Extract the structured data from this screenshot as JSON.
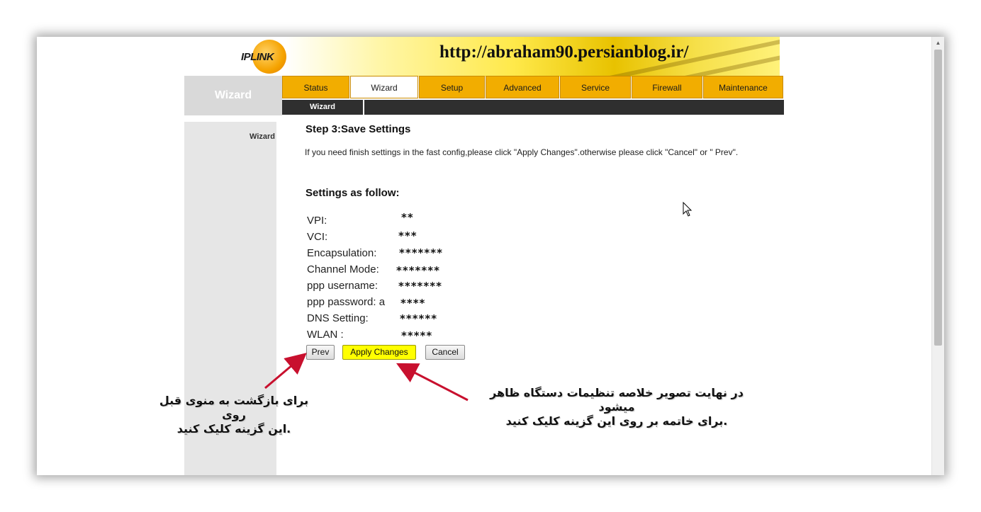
{
  "banner": {
    "logo_text": "IPLINK",
    "url": "http://abraham90.persianblog.ir/"
  },
  "sidebar": {
    "title": "Wizard",
    "items": [
      {
        "label": "Wizard"
      }
    ]
  },
  "nav": {
    "tabs": [
      {
        "label": "Status"
      },
      {
        "label": "Wizard"
      },
      {
        "label": "Setup"
      },
      {
        "label": "Advanced"
      },
      {
        "label": "Service"
      },
      {
        "label": "Firewall"
      },
      {
        "label": "Maintenance"
      }
    ],
    "active_tab": "Wizard",
    "sub_items": [
      {
        "label": "Wizard"
      }
    ]
  },
  "main": {
    "step_title": "Step 3:Save Settings",
    "instruction": "If you need finish settings in the fast config,please click \"Apply Changes\".otherwise please click \"Cancel\" or \" Prev\".",
    "settings_title": "Settings as follow:",
    "settings": [
      {
        "label": "VPI:",
        "masked": "**"
      },
      {
        "label": "VCI:",
        "masked": "***"
      },
      {
        "label": "Encapsulation:",
        "masked": "*******"
      },
      {
        "label": "Channel Mode:",
        "masked": "*******"
      },
      {
        "label": "ppp username:",
        "masked": "*******"
      },
      {
        "label": "ppp password: a",
        "masked": "****"
      },
      {
        "label": "DNS Setting:",
        "masked": "******"
      },
      {
        "label": "WLAN :",
        "masked": "*****"
      }
    ]
  },
  "buttons": {
    "prev": "Prev",
    "apply": "Apply Changes",
    "cancel": "Cancel"
  },
  "annotations": {
    "left_line1": "برای بازگشت به منوی قبل روی",
    "left_line2": ".این گزینه کلیک کنید",
    "right_line1": "در نهایت تصویر خلاصه تنظیمات دستگاه ظاهر میشود",
    "right_line2": ".برای خاتمه بر روی این گزینه کلیک کنید"
  },
  "colors": {
    "nav_tab": "#f2ad00",
    "subnav": "#2f2f2f",
    "apply_button": "#ffff00",
    "arrow": "#c8102e"
  }
}
